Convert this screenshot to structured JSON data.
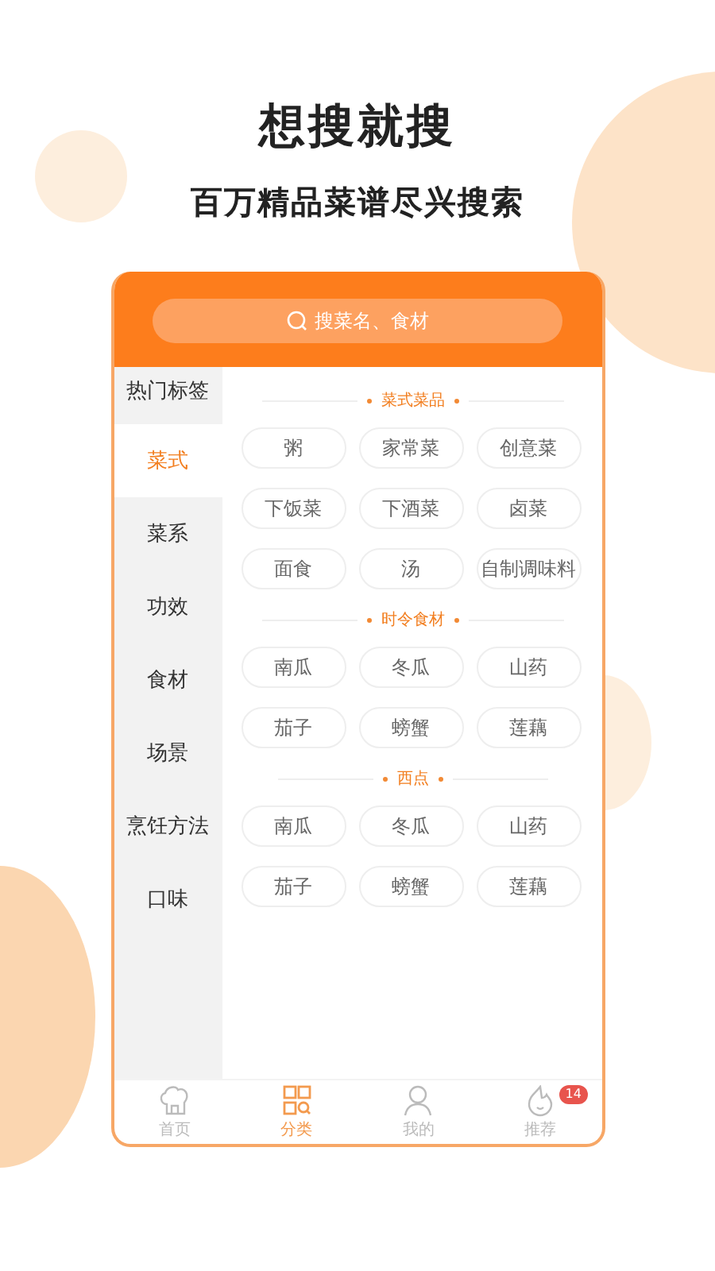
{
  "headline": "想搜就搜",
  "subtitle": "百万精品菜谱尽兴搜索",
  "search": {
    "placeholder": "搜菜名、食材"
  },
  "sidebar": {
    "items": [
      {
        "label": "热门标签",
        "selected": false
      },
      {
        "label": "菜式",
        "selected": true
      },
      {
        "label": "菜系",
        "selected": false
      },
      {
        "label": "功效",
        "selected": false
      },
      {
        "label": "食材",
        "selected": false
      },
      {
        "label": "场景",
        "selected": false
      },
      {
        "label": "烹饪方法",
        "selected": false
      },
      {
        "label": "口味",
        "selected": false
      }
    ]
  },
  "sections": [
    {
      "title": "菜式菜品",
      "tags": [
        "粥",
        "家常菜",
        "创意菜",
        "下饭菜",
        "下酒菜",
        "卤菜",
        "面食",
        "汤",
        "自制调味料"
      ]
    },
    {
      "title": "时令食材",
      "tags": [
        "南瓜",
        "冬瓜",
        "山药",
        "茄子",
        "螃蟹",
        "莲藕"
      ]
    },
    {
      "title": "西点",
      "tags": [
        "南瓜",
        "冬瓜",
        "山药",
        "茄子",
        "螃蟹",
        "莲藕"
      ]
    }
  ],
  "tab_bar": [
    {
      "kind": "home",
      "label": "首页",
      "selected": false
    },
    {
      "kind": "category",
      "label": "分类",
      "selected": true
    },
    {
      "kind": "profile",
      "label": "我的",
      "selected": false
    },
    {
      "kind": "recommend",
      "label": "推荐",
      "selected": false,
      "badge": "14"
    }
  ]
}
